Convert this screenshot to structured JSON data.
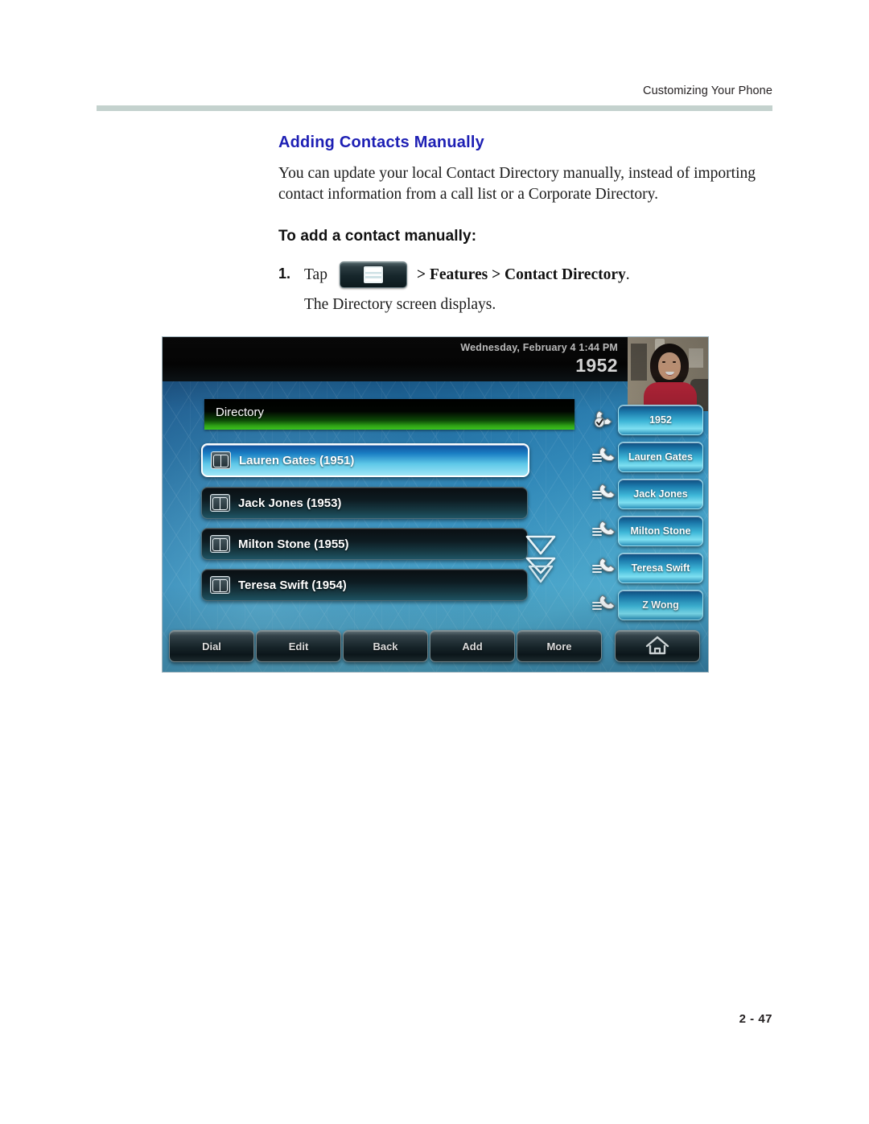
{
  "page": {
    "running_head": "Customizing Your Phone",
    "folio": "2 - 47",
    "heading": "Adding Contacts Manually",
    "intro": "You can update your local Contact Directory manually, instead of importing contact information from a call list or a Corporate Directory.",
    "subheading": "To add a contact manually:",
    "step": {
      "number": "1.",
      "tap_label": "Tap",
      "menu_key_icon": "menu-key-icon",
      "path_bold": "> Features > Contact Directory",
      "path_period": ".",
      "result": "The Directory screen displays."
    },
    "colors": {
      "heading_blue": "#1d1fb4",
      "rule_gray_green": "#c4d2ce",
      "body_text": "#1a1a1a"
    }
  },
  "phone": {
    "status": {
      "datetime": "Wednesday, February 4  1:44 PM",
      "extension": "1952"
    },
    "avatar_label": "user-photo",
    "screen_title": "Directory",
    "contacts": [
      {
        "icon": "contact-book-icon",
        "label": "Lauren Gates (1951)",
        "selected": true
      },
      {
        "icon": "contact-book-icon",
        "label": "Jack Jones (1953)",
        "selected": false
      },
      {
        "icon": "contact-book-icon",
        "label": "Milton Stone (1955)",
        "selected": false
      },
      {
        "icon": "contact-book-icon",
        "label": "Teresa Swift (1954)",
        "selected": false
      }
    ],
    "scroll_indicators": [
      "chevron-down-icon",
      "chevron-double-down-icon"
    ],
    "line_keys": [
      {
        "label": "1952",
        "icon": "handset-registered-icon"
      },
      {
        "label": "Lauren Gates",
        "icon": "handset-speeddial-icon"
      },
      {
        "label": "Jack Jones",
        "icon": "handset-speeddial-icon"
      },
      {
        "label": "Milton Stone",
        "icon": "handset-speeddial-icon"
      },
      {
        "label": "Teresa Swift",
        "icon": "handset-speeddial-icon"
      },
      {
        "label": "Z Wong",
        "icon": "handset-speeddial-icon"
      }
    ],
    "soft_keys": [
      {
        "label": "Dial",
        "icon": null
      },
      {
        "label": "Edit",
        "icon": null
      },
      {
        "label": "Back",
        "icon": null
      },
      {
        "label": "Add",
        "icon": null
      },
      {
        "label": "More",
        "icon": null
      },
      {
        "label": "",
        "icon": "home-icon"
      }
    ],
    "colors": {
      "screen_blue": "#2b82b4",
      "title_green": "#3cc41b",
      "linekey_cyan": "#3fb7d8",
      "selected_row": "#5ec8e8"
    }
  }
}
